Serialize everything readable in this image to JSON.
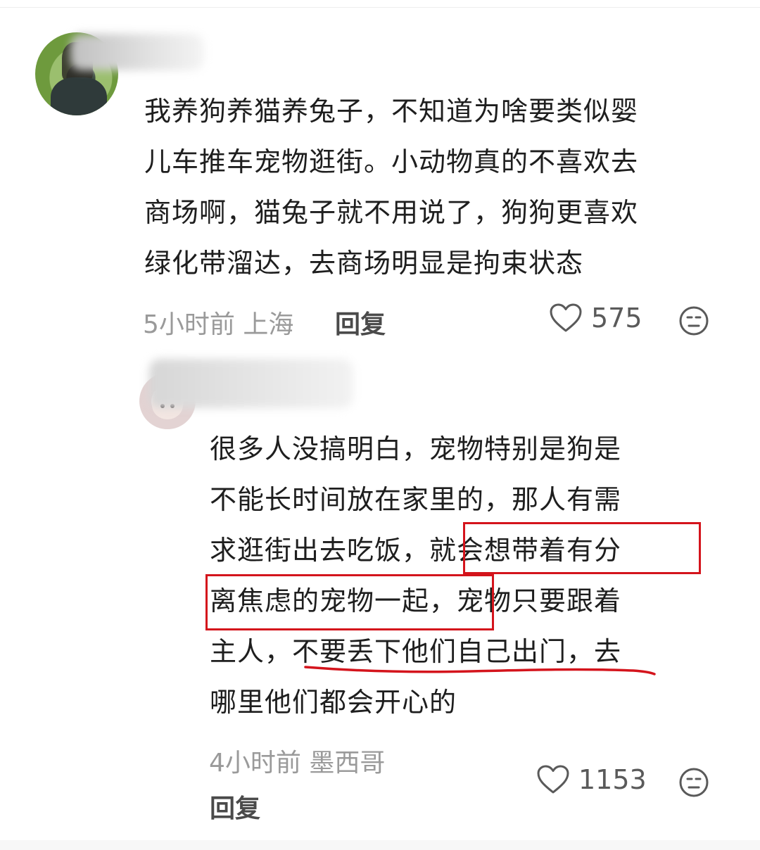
{
  "comments": [
    {
      "text_lines": [
        "我养狗养猫养兔子，不知道为啥要类似婴",
        "儿车推车宠物逛街。小动物真的不喜欢去",
        "商场啊，猫兔子就不用说了，狗狗更喜欢",
        "绿化带溜达，去商场明显是拘束状态"
      ],
      "time_location": "5小时前 上海",
      "reply_label": "回复",
      "likes": "575",
      "icons": {
        "like": "heart-icon",
        "react": "neutral-face-icon"
      }
    },
    {
      "text_lines": [
        "很多人没搞明白，宠物特别是狗是",
        "不能长时间放在家里的，那人有需",
        "求逛街出去吃饭，就会想带着有分",
        "离焦虑的宠物一起，宠物只要跟着",
        "主人，不要丢下他们自己出门，去",
        "哪里他们都会开心的"
      ],
      "time_location": "4小时前 墨西哥",
      "reply_label": "回复",
      "likes": "1153",
      "icons": {
        "like": "heart-icon",
        "react": "neutral-face-icon"
      }
    }
  ],
  "colors": {
    "annotation": "#d4141c",
    "meta_text": "#9a9a9a",
    "body_text": "#1e1e1e"
  }
}
